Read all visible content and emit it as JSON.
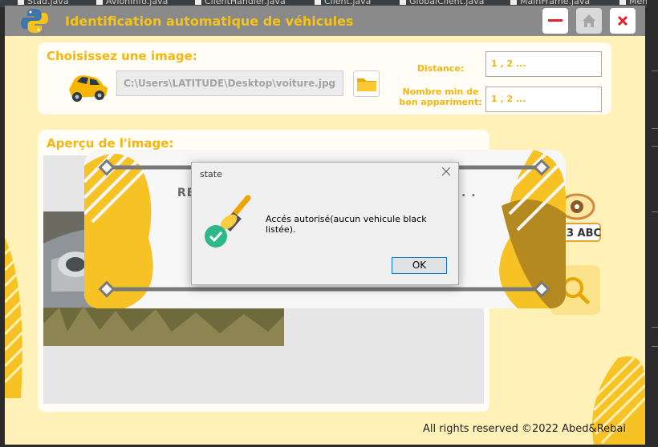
{
  "ide": {
    "tabs": [
      "Stad.java",
      "AvionInfo.java",
      "ClientHandler.java",
      "Client.java",
      "GlobalClient.java",
      "MainFrame.java",
      "Menu..."
    ]
  },
  "window": {
    "title": "Identification automatique de véhicules",
    "logo_icon": "python-logo-icon",
    "buttons": {
      "minimize_icon": "minimize-icon",
      "home_icon": "home-icon",
      "close_icon": "close-icon"
    }
  },
  "image_select": {
    "label": "Choisissez une image:",
    "path_value": "C:\\Users\\LATITUDE\\Desktop\\voiture.jpg",
    "car_icon": "car-icon",
    "browse_icon": "folder-icon"
  },
  "params": {
    "distance_label": "Distance:",
    "distance_value": "1 , 2 ...",
    "min_match_label_line1": "Nombre min de",
    "min_match_label_line2": "bon appariment:",
    "min_match_value": "1 , 2 ..."
  },
  "preview": {
    "label": "Aperçu de l'image:"
  },
  "overlay": {
    "text_start": "RE",
    "text_end": ". ."
  },
  "right_icons": {
    "plate_text": "23 ABC",
    "plate_icon": "eye-plate-icon",
    "search_icon": "search-icon"
  },
  "dialog": {
    "title": "state",
    "message": "Accés autorisé(aucun vehicule black listée).",
    "ok_label": "OK",
    "icon": "paintbrush-check-icon",
    "close_icon": "close-icon"
  },
  "footer": {
    "text": "All rights reserved ©2022    Abed&Rebai"
  },
  "colors": {
    "accent": "#f6b60e",
    "app_bg": "#fff1b8",
    "titlebar": "#8a8a8a",
    "close_red": "#e0232e"
  }
}
